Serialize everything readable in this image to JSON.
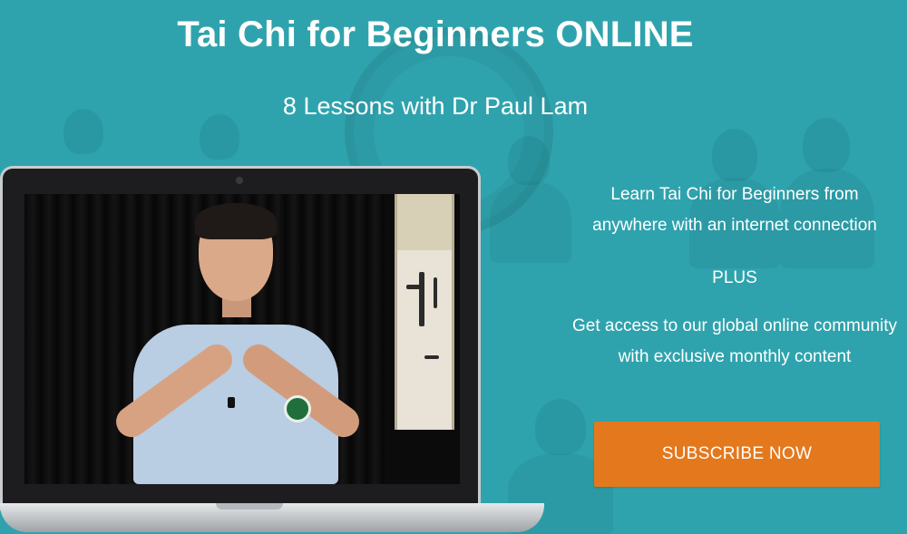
{
  "hero": {
    "title": "Tai Chi for Beginners ONLINE",
    "subtitle": "8 Lessons with Dr Paul Lam",
    "description_line1": "Learn Tai Chi for Beginners from",
    "description_line2": "anywhere with an internet connection",
    "plus": "PLUS",
    "access_line1": "Get access to our global online community",
    "access_line2": "with exclusive monthly content",
    "cta_label": "SUBSCRIBE NOW"
  },
  "colors": {
    "background": "#2fa3ad",
    "cta": "#e4781d",
    "text": "#ffffff"
  }
}
